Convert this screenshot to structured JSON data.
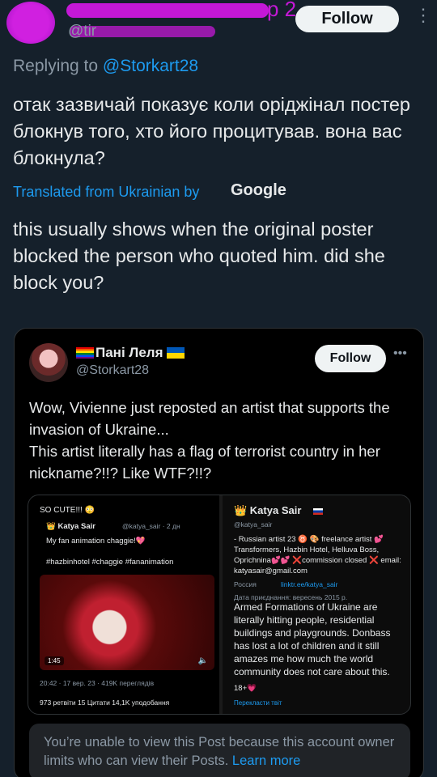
{
  "header": {
    "blurred_name_tail": "р 2",
    "blurred_handle": "@tir",
    "follow_label": "Follow",
    "more_icon": "more-vertical-icon"
  },
  "reply": {
    "prefix": "Replying to ",
    "mention": "@Storkart28"
  },
  "tweet": {
    "original_text": "отак зазвичай показує коли оріджінал постер блокнув того, хто його процитував. вона вас блокнула?",
    "translated_label": "Translated from Ukrainian by",
    "translator_brand": "Google",
    "translated_text": "this usually shows when the original poster blocked the person who quoted him. did she block you?"
  },
  "quote": {
    "display_name": "Пані Леля",
    "handle": "@Storkart28",
    "follow_label": "Follow",
    "more_icon": "more-horizontal-icon",
    "text_line1": "Wow, Vivienne just reposted an artist that supports the invasion of Ukraine...",
    "text_line2": "This artist literally has a flag of terrorist country in her nickname?!!? Like WTF?!!?",
    "embedded": {
      "left_title": "SO CUTE!!! 😳",
      "left_author": "👑 Katya Sair",
      "left_meta": "@katya_sair · 2 дн",
      "left_caption": "My fan animation chaggie!💖",
      "left_tags": "#hazbinhotel #chaggie #fananimation",
      "video_time": "1:45",
      "left_footer": "20:42 · 17 вер. 23 · 419K переглядів",
      "left_stats": "973 ретвіти   15 Цитати   14,1K уподобання",
      "right_name": "👑 Katya Sair",
      "right_handle": "@katya_sair",
      "right_bio": "- Russian artist 23 ♉ 🎨 freelance artist 💕 Transformers, Hazbin Hotel, Helluva Boss, Oprichnina💕💕 ❌commission closed ❌ email: katyasair@gmail.com",
      "right_location": "Россия",
      "right_link": "linktr.ee/katya_sair",
      "right_joined": "Дата приєднання: вересень 2015 р.",
      "right_overlay_text": "Armed Formations of Ukraine are literally hitting people, residential buildings and playgrounds. Donbass has lost a lot of children and it still amazes me how much the world community does not care about this.",
      "right_age": "18+💗",
      "right_translate": "Перекласти твіт"
    },
    "restricted_text": "You’re unable to view this Post because this account owner limits who can view their Posts.",
    "restricted_link": "Learn more"
  },
  "colors": {
    "background": "#15202b",
    "card_background": "#000000",
    "accent_blue": "#1d9bf0",
    "blur_magenta": "#c418d6"
  }
}
